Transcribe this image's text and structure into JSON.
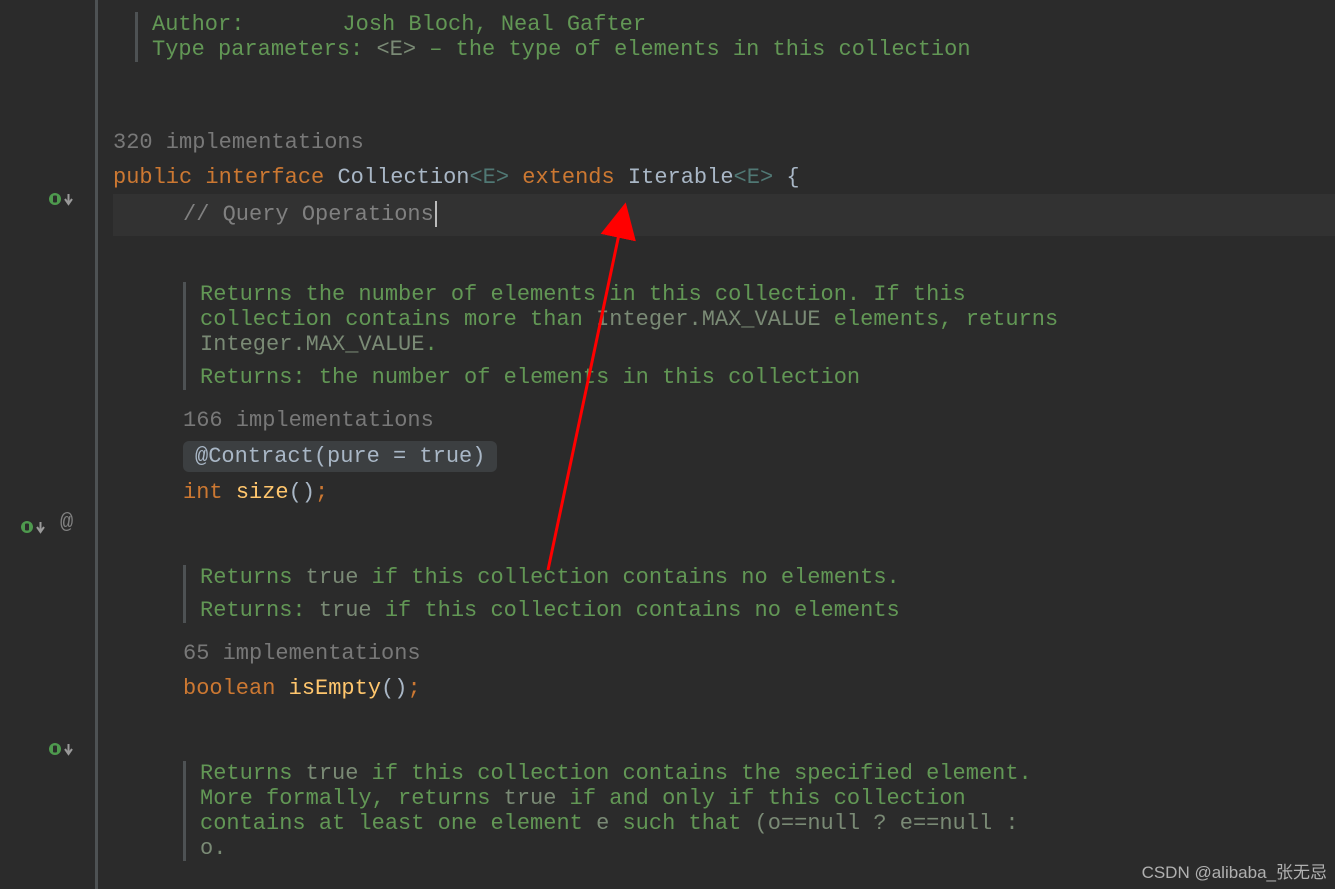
{
  "header_doc": {
    "author_label": "Author:",
    "author_value": "Josh Bloch, Neal Gafter",
    "typeparams_label": "Type parameters:",
    "typeparams_value_code": "<E>",
    "typeparams_value_text": " – the type of elements in this collection"
  },
  "declaration": {
    "impl_count": "320 implementations",
    "kw_public": "public ",
    "kw_interface": "interface ",
    "name": "Collection",
    "generic": "<E>",
    "kw_extends": " extends ",
    "supertype": "Iterable",
    "super_generic": "<E>",
    "brace": " {"
  },
  "comment_query": "// Query Operations",
  "size": {
    "doc_line1_a": "Returns the number of elements in this collection. If this collection contains more than ",
    "doc_line1_code": "Integer.MAX_VALUE",
    "doc_line1_c": " elements, returns ",
    "doc_line1_code2": "Integer.MAX_VALUE",
    "doc_line1_d": ".",
    "returns_label": "Returns: ",
    "returns_text": "the number of elements in this collection",
    "impl_count": "166 implementations",
    "contract": "@Contract(pure = true)",
    "kw_type": "int ",
    "name": "size",
    "paren": "()",
    "semi": ";"
  },
  "isEmpty": {
    "doc_a": "Returns ",
    "doc_code": "true",
    "doc_b": " if this collection contains no elements.",
    "returns_label": "Returns: ",
    "returns_code": "true",
    "returns_b": " if this collection contains no elements",
    "impl_count": "65 implementations",
    "kw_type": "boolean ",
    "name": "isEmpty",
    "paren": "()",
    "semi": ";"
  },
  "contains": {
    "doc_a": "Returns ",
    "doc_code": "true",
    "doc_b": " if this collection contains the specified element. More formally, returns ",
    "doc_code2": "true",
    "doc_c": " if and only if this collection contains at least one element ",
    "doc_code3": "e",
    "doc_d": " such that ",
    "doc_code4": "(o==null ? e==null : o."
  },
  "watermark": "CSDN @alibaba_张无忌"
}
